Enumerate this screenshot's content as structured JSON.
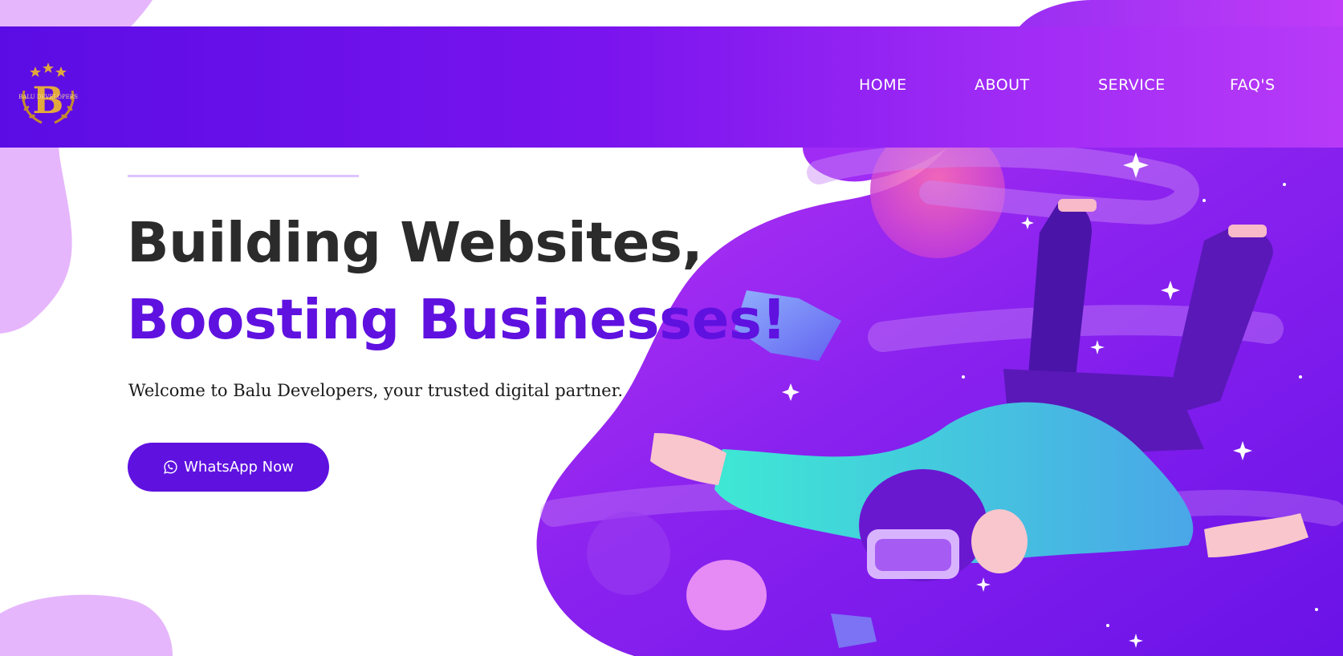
{
  "header": {
    "logo": {
      "icon": "balu-developers-logo-icon",
      "letter": "B",
      "text": "BALU DEVELOPERS"
    },
    "nav": [
      {
        "label": "HOME"
      },
      {
        "label": "ABOUT"
      },
      {
        "label": "SERVICE"
      },
      {
        "label": "FAQ'S"
      }
    ]
  },
  "hero": {
    "headline_line1": "Building Websites,",
    "headline_line2": "Boosting Businesses!",
    "subtitle": "Welcome to Balu Developers, your trusted digital partner.",
    "cta": {
      "label": "WhatsApp Now",
      "icon": "whatsapp-icon"
    }
  },
  "colors": {
    "accent": "#5f11e0",
    "header_gradient_start": "#5b0ce4",
    "header_gradient_end": "#b83af8",
    "headline_dark": "#2b2b2b",
    "blob_light": "#e3b3fb"
  }
}
